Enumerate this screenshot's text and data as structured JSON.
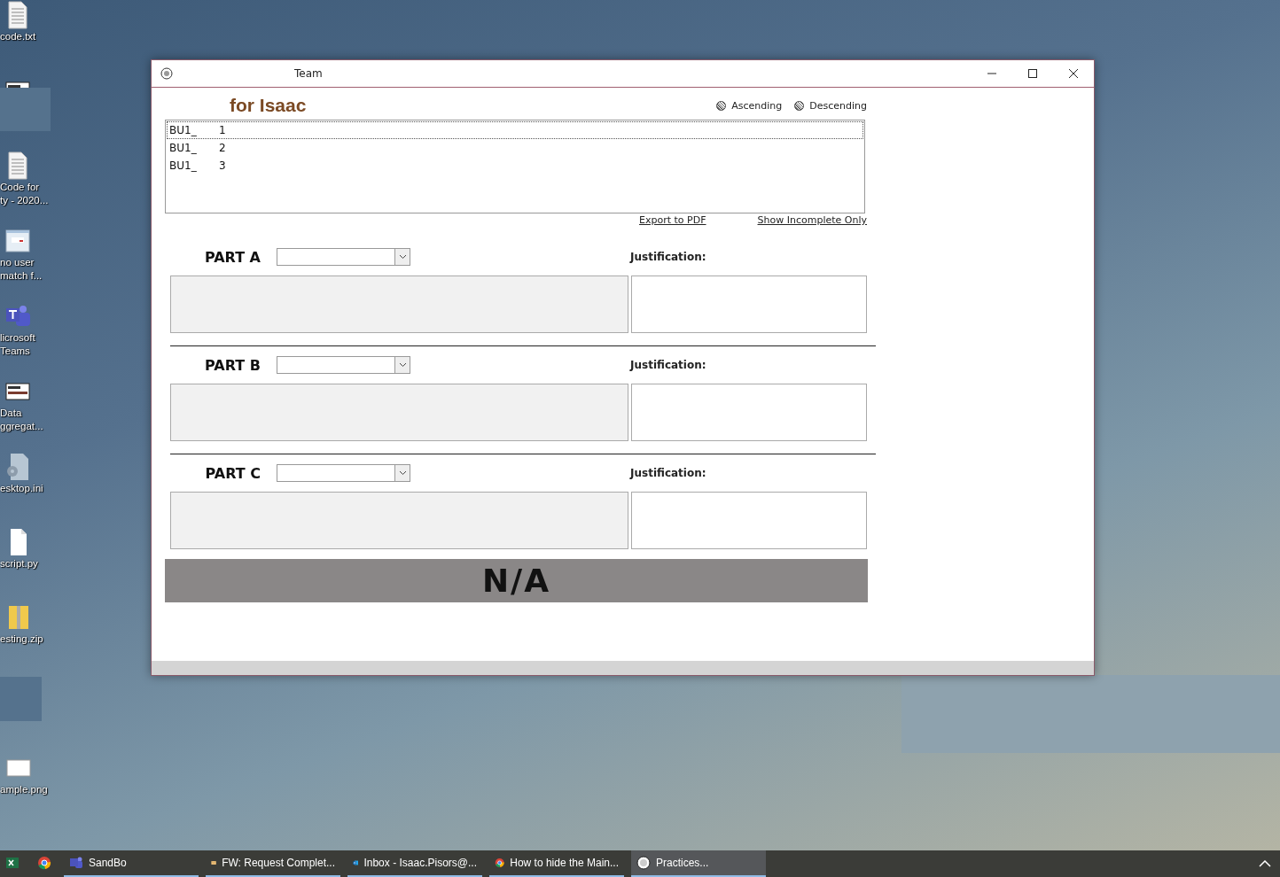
{
  "desktop_icons": [
    {
      "kind": "text",
      "label": "code.txt"
    },
    {
      "kind": "form"
    },
    {
      "kind": "text",
      "label": "Code for\nty - 2020..."
    },
    {
      "kind": "window",
      "label": "no user\nmatch f..."
    },
    {
      "kind": "teams",
      "label": "licrosoft\nTeams"
    },
    {
      "kind": "form",
      "label": "Data\nggregat..."
    },
    {
      "kind": "settings",
      "label": "esktop.ini"
    },
    {
      "kind": "blank",
      "label": "script.py"
    },
    {
      "kind": "zip",
      "label": "esting.zip"
    },
    {
      "kind": "image",
      "label": "ample.png"
    }
  ],
  "window": {
    "title": "Team",
    "heading": "for Isaac",
    "sort_options": [
      {
        "label": "Ascending",
        "selected": false
      },
      {
        "label": "Descending",
        "selected": false
      }
    ],
    "list": [
      {
        "prefix": "BU1_",
        "suffix": "1",
        "selected": true
      },
      {
        "prefix": "BU1_",
        "suffix": "2",
        "selected": false
      },
      {
        "prefix": "BU1_",
        "suffix": "3",
        "selected": false
      }
    ],
    "links": [
      "Export to PDF",
      "Show Incomplete Only"
    ],
    "sections": [
      {
        "label": "PART A",
        "justification_label": "Justification:"
      },
      {
        "label": "PART B",
        "justification_label": "Justification:"
      },
      {
        "label": "PART C",
        "justification_label": "Justification:"
      }
    ],
    "result": "N/A"
  },
  "taskbar": {
    "items": [
      {
        "kind": "excel",
        "selected": false
      },
      {
        "kind": "chrome",
        "selected": false
      },
      {
        "kind": "teams",
        "label": "SandBo",
        "selected": false
      },
      {
        "kind": "mail",
        "label": "FW: Request Complet...",
        "selected": false
      },
      {
        "kind": "outlook",
        "label": "Inbox - Isaac.Pisors@...",
        "selected": false
      },
      {
        "kind": "chrome",
        "label": "How to hide the Main...",
        "selected": false
      },
      {
        "kind": "app",
        "label": "Practices...",
        "selected": true
      }
    ]
  }
}
